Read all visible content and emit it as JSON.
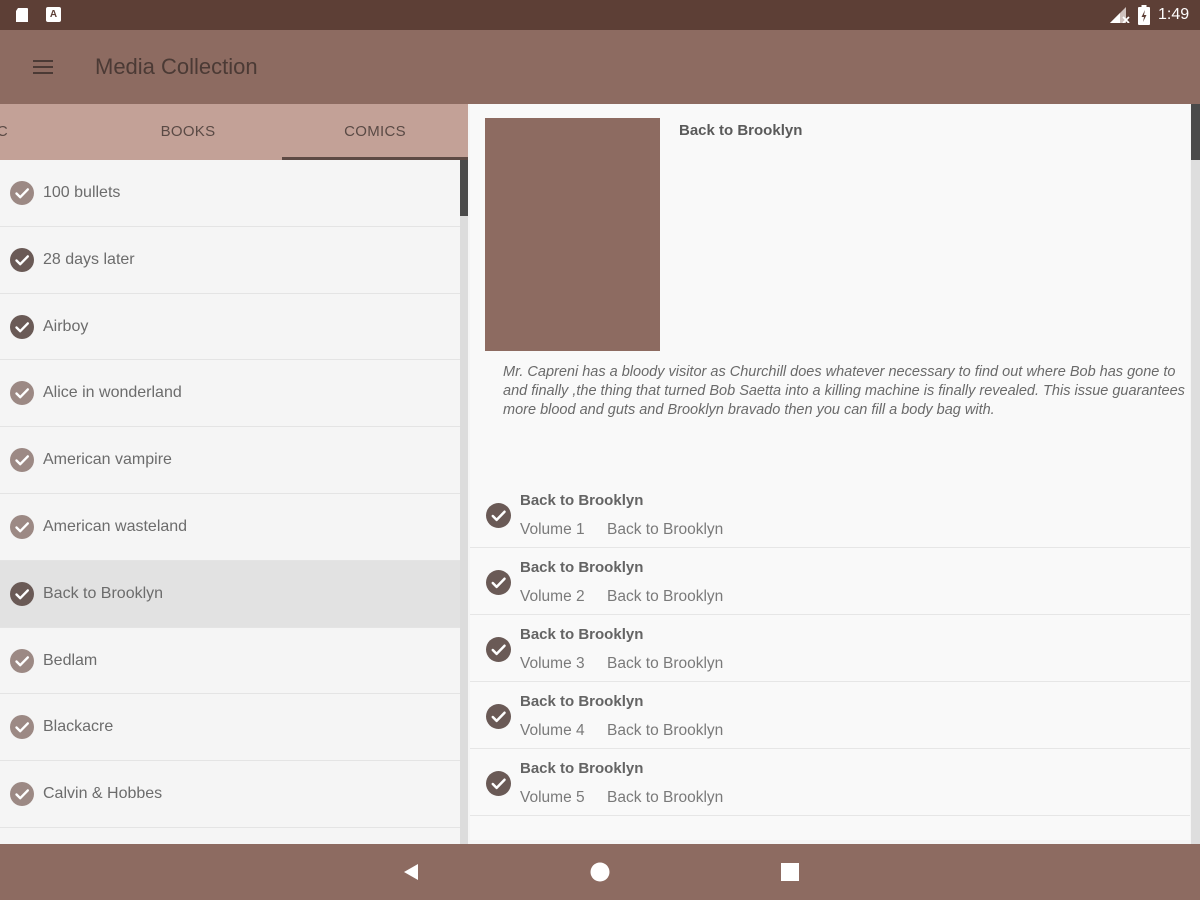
{
  "status_bar": {
    "time": "1:49",
    "icons": [
      "sd-card-icon",
      "a-notification-icon",
      "signal-icon",
      "battery-icon"
    ],
    "notification_letter": "A"
  },
  "app_bar": {
    "title": "Media Collection",
    "menu_icon": "hamburger-menu-icon"
  },
  "tabs": [
    {
      "label": "SIC"
    },
    {
      "label": "BOOKS"
    },
    {
      "label": "COMICS",
      "selected": true
    }
  ],
  "comics_list": [
    {
      "label": "100 bullets"
    },
    {
      "label": "28 days later"
    },
    {
      "label": "Airboy"
    },
    {
      "label": "Alice in wonderland"
    },
    {
      "label": "American vampire"
    },
    {
      "label": "American wasteland"
    },
    {
      "label": "Back to Brooklyn",
      "selected": true
    },
    {
      "label": "Bedlam"
    },
    {
      "label": "Blackacre"
    },
    {
      "label": "Calvin & Hobbes"
    }
  ],
  "detail": {
    "title": "Back to Brooklyn",
    "description": "Mr. Capreni has a bloody visitor as Churchill does whatever necessary to find out where Bob has gone to and finally ,the thing that turned Bob Saetta into a killing machine is finally revealed. This issue guarantees more blood and guts and Brooklyn bravado then you can fill a body bag with.",
    "volumes": [
      {
        "title": "Back to Brooklyn",
        "volume": "Volume 1",
        "series": "Back to Brooklyn"
      },
      {
        "title": "Back to Brooklyn",
        "volume": "Volume 2",
        "series": "Back to Brooklyn"
      },
      {
        "title": "Back to Brooklyn",
        "volume": "Volume 3",
        "series": "Back to Brooklyn"
      },
      {
        "title": "Back to Brooklyn",
        "volume": "Volume 4",
        "series": "Back to Brooklyn"
      },
      {
        "title": "Back to Brooklyn",
        "volume": "Volume 5",
        "series": "Back to Brooklyn"
      }
    ]
  },
  "nav_bar": {
    "icons": [
      "back-icon",
      "home-icon",
      "recents-icon"
    ]
  },
  "colors": {
    "status_bar": "#5d3f36",
    "app_bar": "#8d6b61",
    "tab_bar": "#c3a197",
    "selected_row": "#e2e2e2"
  }
}
